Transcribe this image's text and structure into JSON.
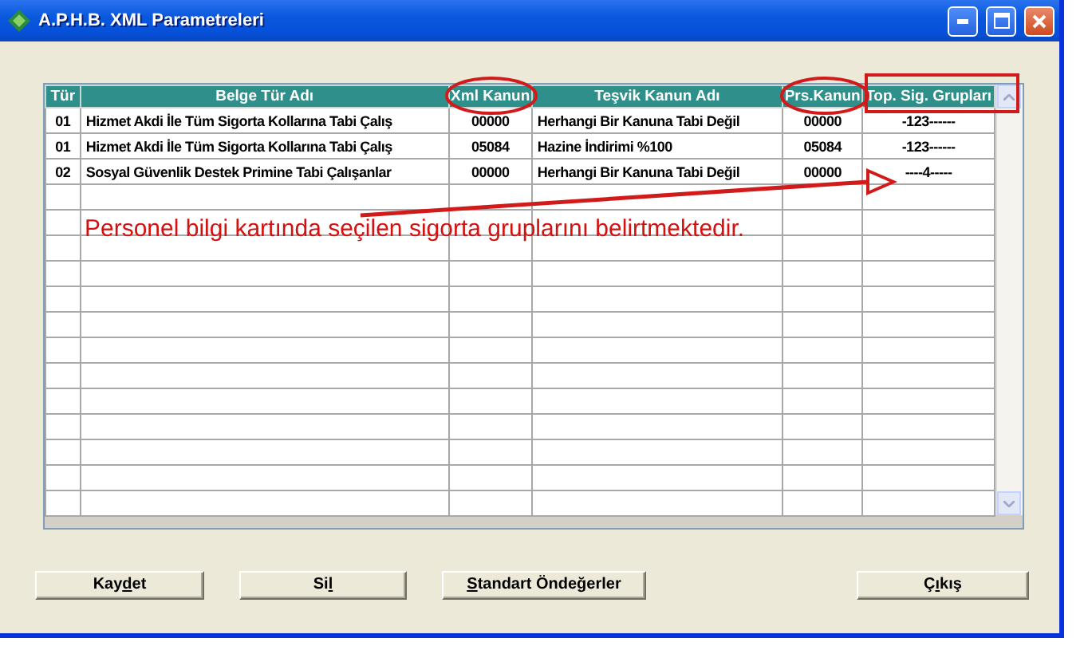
{
  "window": {
    "title": "A.P.H.B. XML Parametreleri"
  },
  "table": {
    "columns": [
      {
        "label": "Tür",
        "kind": "plain"
      },
      {
        "label": "Belge Tür Adı",
        "kind": "plain"
      },
      {
        "label": "Xml Kanun",
        "kind": "circled"
      },
      {
        "label": "Teşvik Kanun Adı",
        "kind": "plain"
      },
      {
        "label": "Prs.Kanun",
        "kind": "circled"
      },
      {
        "label": "Top. Sig. Grupları",
        "kind": "boxed"
      }
    ],
    "rows": [
      [
        "01",
        "Hizmet Akdi İle Tüm Sigorta Kollarına Tabi Çalış",
        "00000",
        "Herhangi Bir Kanuna Tabi Değil",
        "00000",
        "-123------"
      ],
      [
        "01",
        "Hizmet Akdi İle Tüm Sigorta Kollarına Tabi Çalış",
        "05084",
        "Hazine İndirimi %100",
        "05084",
        "-123------"
      ],
      [
        "02",
        "Sosyal Güvenlik Destek Primine Tabi Çalışanlar",
        "00000",
        "Herhangi Bir Kanuna Tabi Değil",
        "00000",
        "----4-----"
      ]
    ]
  },
  "annotation": {
    "note": "Personel bilgi kartında seçilen sigorta gruplarını belirtmektedir."
  },
  "buttons": [
    {
      "before": "Kay",
      "key": "d",
      "after": "et"
    },
    {
      "before": "Si",
      "key": "l"
    },
    {
      "key": "S",
      "after": "tandart Öndeğerler"
    },
    {
      "before": "Ç",
      "key": "ı",
      "after": "kış"
    }
  ]
}
